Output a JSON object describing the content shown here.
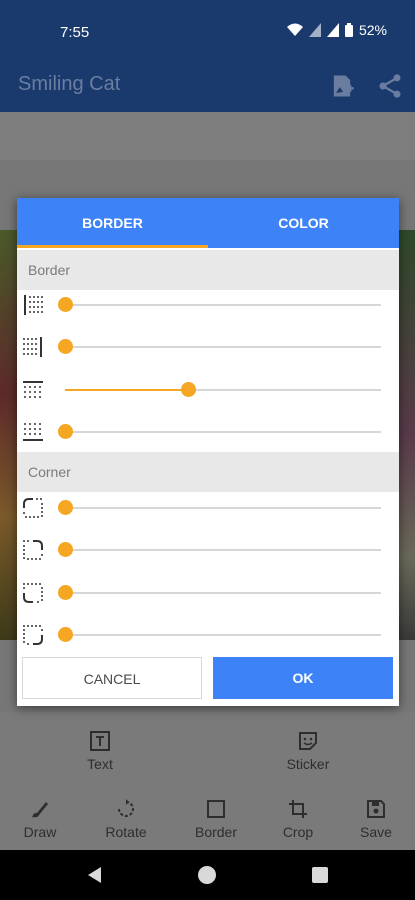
{
  "status_bar": {
    "time": "7:55",
    "battery": "52%"
  },
  "app_bar": {
    "title": "Smiling Cat"
  },
  "dialog": {
    "tabs": [
      {
        "label": "BORDER",
        "active": true
      },
      {
        "label": "COLOR",
        "active": false
      }
    ],
    "border_section": {
      "header": "Border",
      "sliders": [
        {
          "icon": "border-left-icon",
          "value": 0
        },
        {
          "icon": "border-right-icon",
          "value": 0
        },
        {
          "icon": "border-top-icon",
          "value": 0.39
        },
        {
          "icon": "border-bottom-icon",
          "value": 0
        }
      ]
    },
    "corner_section": {
      "header": "Corner",
      "sliders": [
        {
          "icon": "corner-top-left-icon",
          "value": 0
        },
        {
          "icon": "corner-top-right-icon",
          "value": 0
        },
        {
          "icon": "corner-bottom-left-icon",
          "value": 0
        },
        {
          "icon": "corner-bottom-right-icon",
          "value": 0
        }
      ]
    },
    "cancel_label": "CANCEL",
    "ok_label": "OK"
  },
  "toolbar": {
    "text_label": "Text",
    "sticker_label": "Sticker",
    "draw_label": "Draw",
    "rotate_label": "Rotate",
    "border_label": "Border",
    "crop_label": "Crop",
    "save_label": "Save"
  },
  "colors": {
    "accent": "#3d82f6",
    "slider": "#f5a623",
    "app_bar": "#1a3a6e"
  }
}
